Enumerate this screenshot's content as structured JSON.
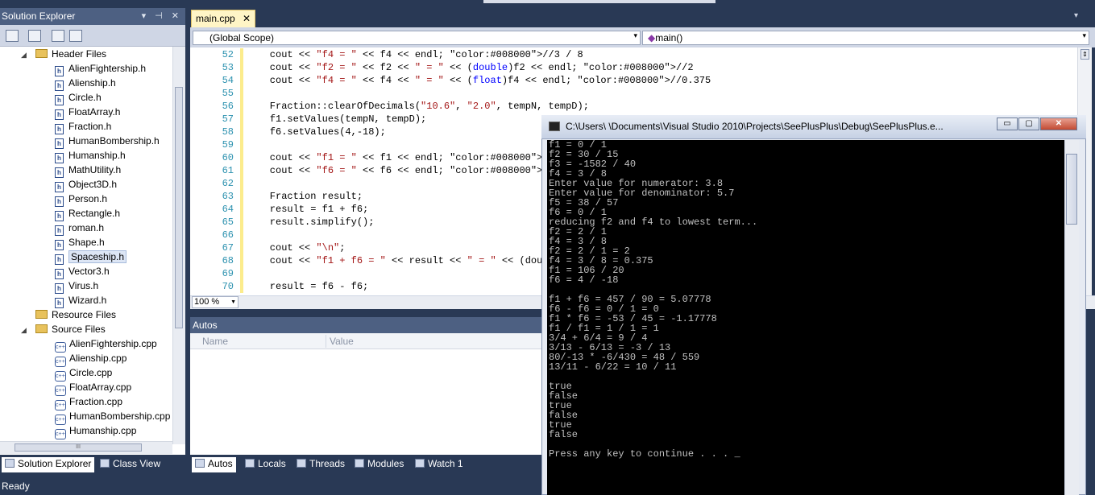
{
  "solution_explorer": {
    "title": "Solution Explorer",
    "tree": [
      {
        "label": "Header Files",
        "kind": "folder",
        "expanded": true,
        "indent": 1
      },
      {
        "label": "AlienFightership.h",
        "kind": "h",
        "indent": 2
      },
      {
        "label": "Alienship.h",
        "kind": "h",
        "indent": 2
      },
      {
        "label": "Circle.h",
        "kind": "h",
        "indent": 2
      },
      {
        "label": "FloatArray.h",
        "kind": "h",
        "indent": 2
      },
      {
        "label": "Fraction.h",
        "kind": "h",
        "indent": 2
      },
      {
        "label": "HumanBombership.h",
        "kind": "h",
        "indent": 2
      },
      {
        "label": "Humanship.h",
        "kind": "h",
        "indent": 2
      },
      {
        "label": "MathUtility.h",
        "kind": "h",
        "indent": 2
      },
      {
        "label": "Object3D.h",
        "kind": "h",
        "indent": 2
      },
      {
        "label": "Person.h",
        "kind": "h",
        "indent": 2
      },
      {
        "label": "Rectangle.h",
        "kind": "h",
        "indent": 2
      },
      {
        "label": "roman.h",
        "kind": "h",
        "indent": 2
      },
      {
        "label": "Shape.h",
        "kind": "h",
        "indent": 2
      },
      {
        "label": "Spaceship.h",
        "kind": "h",
        "indent": 2,
        "selected": true
      },
      {
        "label": "Vector3.h",
        "kind": "h",
        "indent": 2
      },
      {
        "label": "Virus.h",
        "kind": "h",
        "indent": 2
      },
      {
        "label": "Wizard.h",
        "kind": "h",
        "indent": 2
      },
      {
        "label": "Resource Files",
        "kind": "folder",
        "expanded": false,
        "indent": 1
      },
      {
        "label": "Source Files",
        "kind": "folder",
        "expanded": true,
        "indent": 1
      },
      {
        "label": "AlienFightership.cpp",
        "kind": "cpp",
        "indent": 2
      },
      {
        "label": "Alienship.cpp",
        "kind": "cpp",
        "indent": 2
      },
      {
        "label": "Circle.cpp",
        "kind": "cpp",
        "indent": 2
      },
      {
        "label": "FloatArray.cpp",
        "kind": "cpp",
        "indent": 2
      },
      {
        "label": "Fraction.cpp",
        "kind": "cpp",
        "indent": 2
      },
      {
        "label": "HumanBombership.cpp",
        "kind": "cpp",
        "indent": 2
      },
      {
        "label": "Humanship.cpp",
        "kind": "cpp",
        "indent": 2
      }
    ],
    "tabs": [
      "Solution Explorer",
      "Class View"
    ],
    "hscroll_glyph": "III"
  },
  "editor": {
    "doc_tab": "main.cpp",
    "doc_tab_close": "✕",
    "scope_combo": "(Global Scope)",
    "member_combo": "main()",
    "zoom": "100 %",
    "lines": [
      {
        "n": "52",
        "text": "    cout << \"f4 = \" << f4 << endl; //3 / 8"
      },
      {
        "n": "53",
        "text": "    cout << \"f2 = \" << f2 << \" = \" << (double)f2 << endl; //2"
      },
      {
        "n": "54",
        "text": "    cout << \"f4 = \" << f4 << \" = \" << (float)f4 << endl; //0.375"
      },
      {
        "n": "55",
        "text": ""
      },
      {
        "n": "56",
        "text": "    Fraction::clearOfDecimals(\"10.6\", \"2.0\", tempN, tempD);"
      },
      {
        "n": "57",
        "text": "    f1.setValues(tempN, tempD);"
      },
      {
        "n": "58",
        "text": "    f6.setValues(4,-18);"
      },
      {
        "n": "59",
        "text": ""
      },
      {
        "n": "60",
        "text": "    cout << \"f1 = \" << f1 << endl; //106 / 20"
      },
      {
        "n": "61",
        "text": "    cout << \"f6 = \" << f6 << endl; //4 / -18"
      },
      {
        "n": "62",
        "text": ""
      },
      {
        "n": "63",
        "text": "    Fraction result;"
      },
      {
        "n": "64",
        "text": "    result = f1 + f6;"
      },
      {
        "n": "65",
        "text": "    result.simplify();"
      },
      {
        "n": "66",
        "text": ""
      },
      {
        "n": "67",
        "text": "    cout << \"\\n\";"
      },
      {
        "n": "68",
        "text": "    cout << \"f1 + f6 = \" << result << \" = \" << (doub"
      },
      {
        "n": "69",
        "text": ""
      },
      {
        "n": "70",
        "text": "    result = f6 - f6;"
      }
    ]
  },
  "autos": {
    "title": "Autos",
    "columns": [
      "Name",
      "Value"
    ],
    "tabs": [
      "Autos",
      "Locals",
      "Threads",
      "Modules",
      "Watch 1"
    ]
  },
  "console": {
    "title": "C:\\Users\\                \\Documents\\Visual Studio 2010\\Projects\\SeePlusPlus\\Debug\\SeePlusPlus.e...",
    "buttons": [
      "▭",
      "▢",
      "✕"
    ],
    "lines": [
      "f1 = 0 / 1",
      "f2 = 30 / 15",
      "f3 = -1582 / 40",
      "f4 = 3 / 8",
      "Enter value for numerator: 3.8",
      "Enter value for denominator: 5.7",
      "f5 = 38 / 57",
      "f6 = 0 / 1",
      "reducing f2 and f4 to lowest term...",
      "f2 = 2 / 1",
      "f4 = 3 / 8",
      "f2 = 2 / 1 = 2",
      "f4 = 3 / 8 = 0.375",
      "f1 = 106 / 20",
      "f6 = 4 / -18",
      "",
      "f1 + f6 = 457 / 90 = 5.07778",
      "f6 - f6 = 0 / 1 = 0",
      "f1 * f6 = -53 / 45 = -1.17778",
      "f1 / f1 = 1 / 1 = 1",
      "3/4 + 6/4 = 9 / 4",
      "3/13 - 6/13 = -3 / 13",
      "80/-13 * -6/430 = 48 / 559",
      "13/11 - 6/22 = 10 / 11",
      "",
      "true",
      "false",
      "true",
      "false",
      "true",
      "false",
      "",
      "Press any key to continue . . . _"
    ]
  },
  "status": {
    "text": "Ready"
  },
  "colors": {
    "chrome": "#293955",
    "toolwindow_title": "#4d6082",
    "line_number": "#2b91af"
  }
}
